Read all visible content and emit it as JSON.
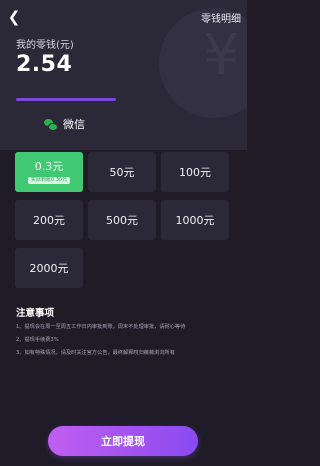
{
  "header": {
    "back_icon": "chevron-left-icon",
    "detail_link": "零钱明细",
    "balance_label": "我的零钱(元)",
    "balance_value": "2.54",
    "bg_glyph": "¥"
  },
  "method": {
    "icon": "wechat-icon",
    "label": "微信"
  },
  "amounts": [
    {
      "label": "0.3元",
      "sub": "实际到账0.30元",
      "selected": true
    },
    {
      "label": "50元"
    },
    {
      "label": "100元"
    },
    {
      "label": "200元"
    },
    {
      "label": "500元"
    },
    {
      "label": "1000元"
    },
    {
      "label": "2000元"
    }
  ],
  "notes": {
    "title": "注意事项",
    "items": [
      "1、提现会在周一至周五工作日内审批到账，周末不处理审批，请耐心等待",
      "2、提现手续费3%",
      "3、如有特殊情况，请及时关注官方公告，最终解释权归薇薇浏浏所有"
    ]
  },
  "cta": {
    "label": "立即提现"
  },
  "colors": {
    "background": "#1f1c28",
    "card": "#2b2838",
    "selected": "#41c872",
    "accent": "#7b49d9"
  }
}
